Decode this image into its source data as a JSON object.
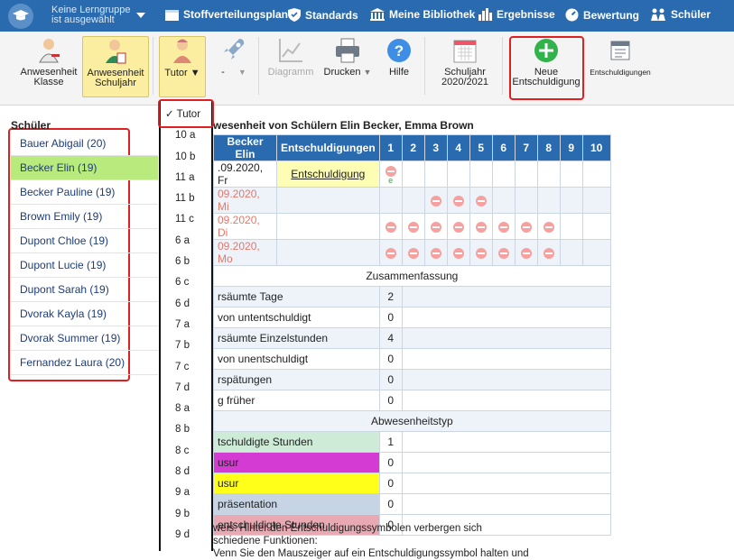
{
  "topbar": {
    "group_line1": "Keine Lerngruppe",
    "group_line2": "ist ausgewählt",
    "nav": [
      "Stoffverteilungsplan",
      "Standards",
      "Meine Bibliothek",
      "Ergebnisse",
      "Bewertung",
      "Schüler"
    ]
  },
  "toolbar": {
    "anw_klasse_1": "Anwesenheit",
    "anw_klasse_2": "Klasse",
    "anw_jahr_1": "Anwesenheit",
    "anw_jahr_2": "Schuljahr",
    "tutor": "Tutor",
    "dash": "-",
    "diagramm": "Diagramm",
    "drucken": "Drucken",
    "hilfe": "Hilfe",
    "schuljahr_1": "Schuljahr",
    "schuljahr_2": "2020/2021",
    "neue_1": "Neue",
    "neue_2": "Entschuldigung",
    "entschuldigungen": "Entschuldigungen"
  },
  "students": {
    "header": "Schüler",
    "items": [
      "Bauer Abigail (20)",
      "Becker Elin (19)",
      "Becker Pauline (19)",
      "Brown Emily (19)",
      "Dupont Chloe (19)",
      "Dupont Lucie (19)",
      "Dupont Sarah (19)",
      "Dvorak Kayla (19)",
      "Dvorak Summer (19)",
      "Fernandez Laura (20)"
    ],
    "selected_index": 1
  },
  "dropdown": {
    "items": [
      "✓ Tutor",
      "10 a",
      "10 b",
      "11 a",
      "11 b",
      "11 c",
      "6 a",
      "6 b",
      "6 c",
      "6 d",
      "7 a",
      "7 b",
      "7 c",
      "7 d",
      "8 a",
      "8 b",
      "8 c",
      "8 d",
      "9 a",
      "9 b",
      "9 d"
    ]
  },
  "main": {
    "title": "wesenheit von Schülern Elin Becker, Emma Brown",
    "col_name": "Becker Elin",
    "col_excuse": "Entschuldigungen",
    "periods": [
      "1",
      "2",
      "3",
      "4",
      "5",
      "6",
      "7",
      "8",
      "9",
      "10"
    ],
    "rows": [
      {
        "date": ".09.2020, Fr",
        "excuse": "Entschuldigung",
        "mark": "e"
      },
      {
        "date": "09.2020, Mi",
        "excuse": ""
      },
      {
        "date": "09.2020, Di",
        "excuse": ""
      },
      {
        "date": "09.2020, Mo",
        "excuse": ""
      }
    ],
    "summary_header": "Zusammenfassung",
    "summary": [
      {
        "label": "rsäumte Tage",
        "value": "2"
      },
      {
        "label": "von untentschuldigt",
        "value": "0"
      },
      {
        "label": "rsäumte Einzelstunden",
        "value": "4"
      },
      {
        "label": "von unentschuldigt",
        "value": "0"
      },
      {
        "label": "rspätungen",
        "value": "0"
      },
      {
        "label": "g früher",
        "value": "0"
      }
    ],
    "type_header": "Abwesenheitstyp",
    "types": [
      {
        "label": "tschuldigte Stunden",
        "value": "1",
        "color": "#cdebd6"
      },
      {
        "label": "usur",
        "value": "0",
        "color": "#d33bd3"
      },
      {
        "label": "usur",
        "value": "0",
        "color": "#ffff1a"
      },
      {
        "label": "präsentation",
        "value": "0",
        "color": "#c6d4e4"
      },
      {
        "label": "entschuldigte  Stunden",
        "value": "0",
        "color": "#e8a9b3"
      }
    ],
    "note1": "weis: Hinter den Entschuldigungssymbolen verbergen sich",
    "note2": "schiedene Funktionen:",
    "note3": "Venn Sie den Mauszeiger auf ein Entschuldigungssymbol halten und"
  }
}
